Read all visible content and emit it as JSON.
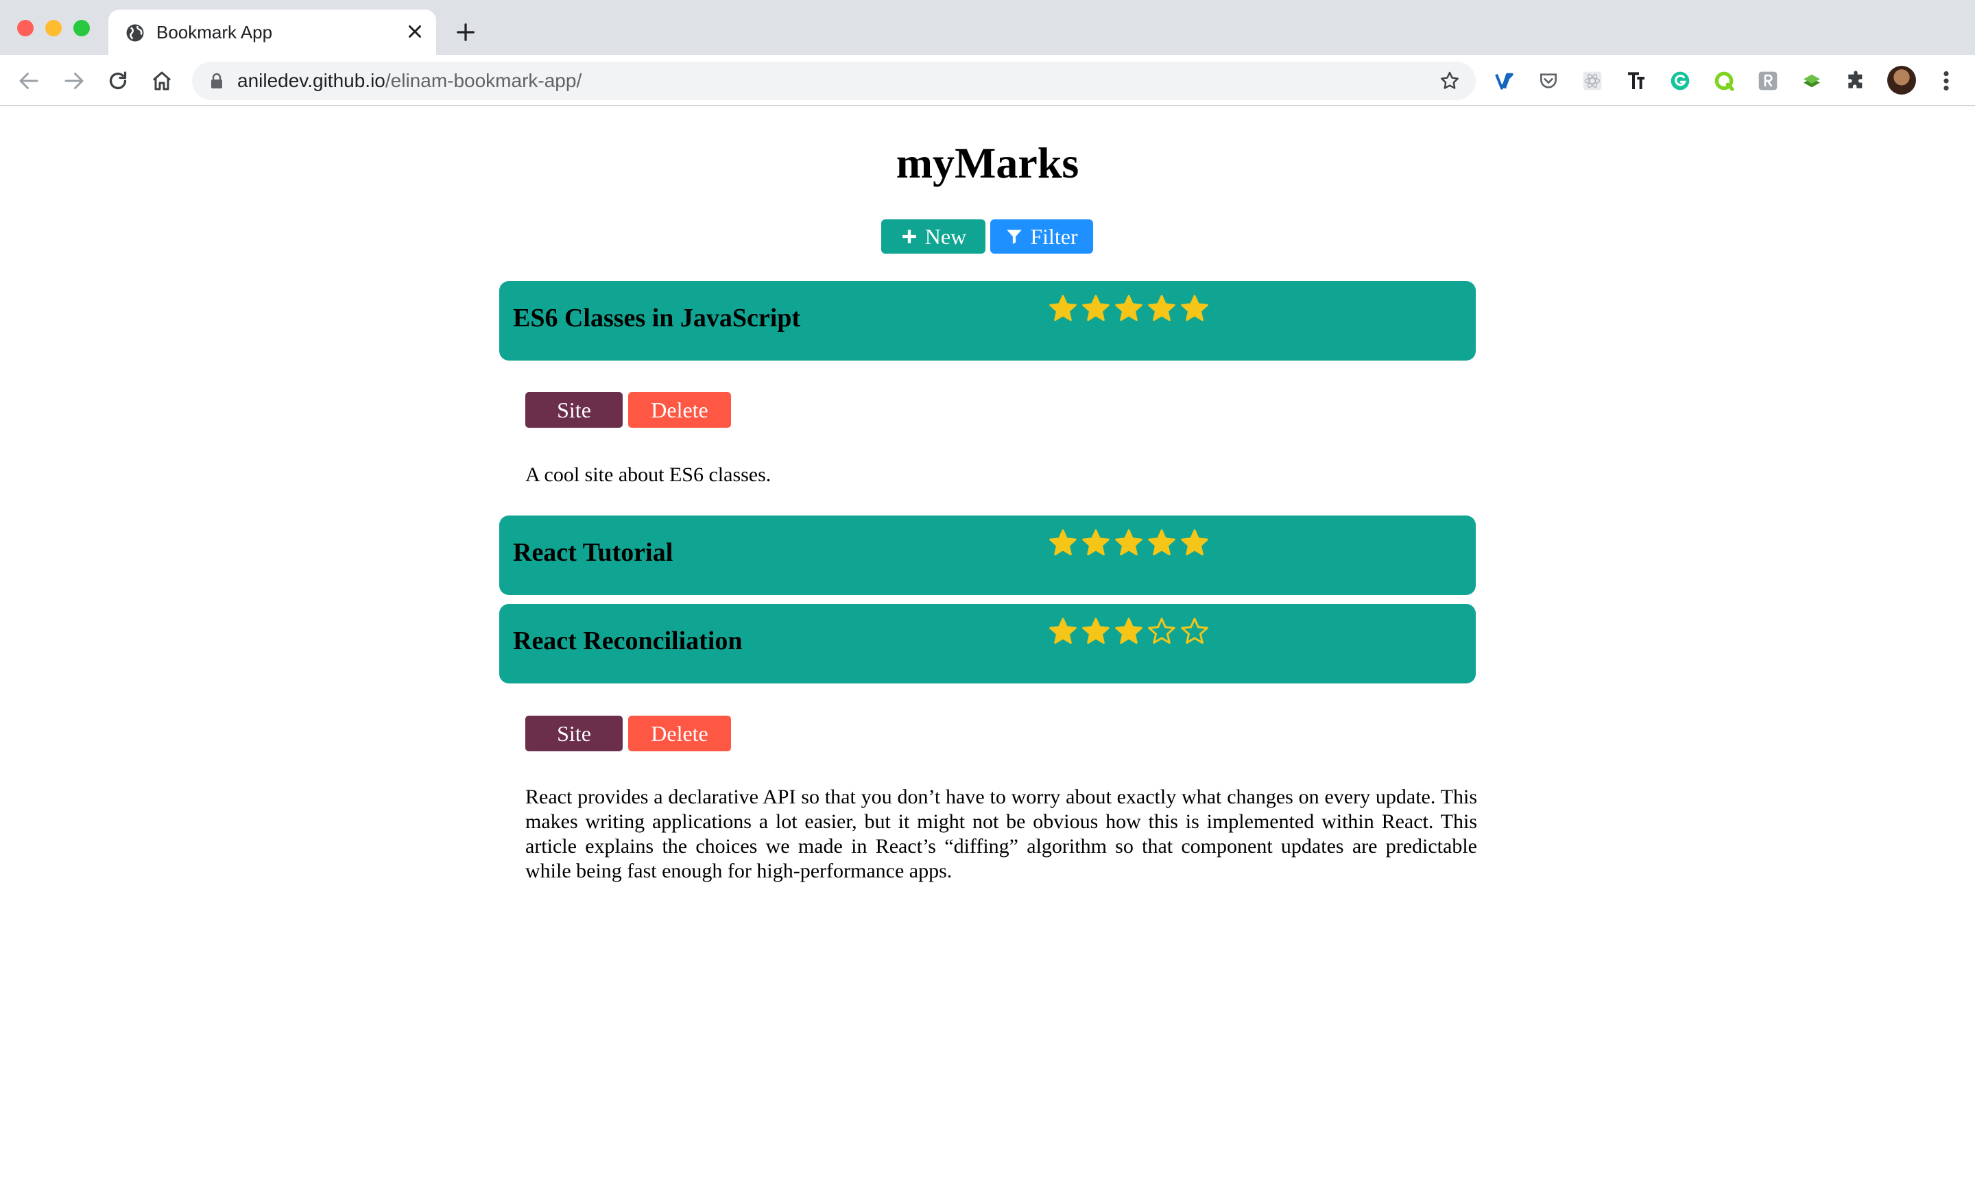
{
  "browser": {
    "tab_title": "Bookmark App",
    "url_host": "aniledev.github.io",
    "url_path": "/elinam-bookmark-app/"
  },
  "app": {
    "title": "myMarks",
    "new_label": "New",
    "filter_label": "Filter",
    "colors": {
      "card": "#10a592",
      "new_button": "#10a592",
      "filter_button": "#1e90ff",
      "site_button": "#6b2e4b",
      "delete_button": "#fe5845",
      "star": "#f5c518"
    }
  },
  "bookmarks": [
    {
      "title": "ES6 Classes in JavaScript",
      "rating": 5,
      "expanded": true,
      "site_label": "Site",
      "delete_label": "Delete",
      "description": "A cool site about ES6 classes."
    },
    {
      "title": "React Tutorial",
      "rating": 5,
      "expanded": false
    },
    {
      "title": "React Reconciliation",
      "rating": 3,
      "expanded": true,
      "site_label": "Site",
      "delete_label": "Delete",
      "description": "React provides a declarative API so that you don’t have to worry about exactly what changes on every update. This makes writing applications a lot easier, but it might not be obvious how this is implemented within React. This article explains the choices we made in React’s “diffing” algorithm so that component updates are predictable while being fast enough for high-performance apps."
    }
  ]
}
